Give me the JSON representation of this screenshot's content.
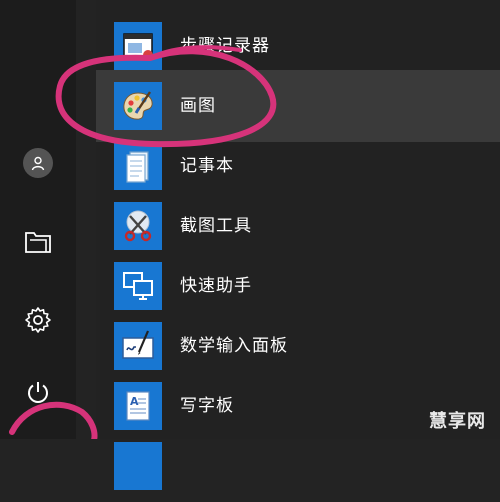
{
  "start_menu": {
    "apps": [
      {
        "label": "步骤记录器",
        "icon": "steps-recorder-icon"
      },
      {
        "label": "画图",
        "icon": "paint-palette-icon"
      },
      {
        "label": "记事本",
        "icon": "notepad-icon"
      },
      {
        "label": "截图工具",
        "icon": "snipping-tool-icon"
      },
      {
        "label": "快速助手",
        "icon": "quick-assist-icon"
      },
      {
        "label": "数学输入面板",
        "icon": "math-input-panel-icon"
      },
      {
        "label": "写字板",
        "icon": "wordpad-icon"
      }
    ],
    "selected_app": "画图",
    "rail_icons": [
      "user-avatar-icon",
      "documents-icon",
      "settings-gear-icon",
      "power-icon"
    ]
  },
  "colors": {
    "tile_blue": "#1877d2",
    "highlight_annotation": "#d6337a",
    "background": "#222222",
    "selected_row": "#3a3a3a"
  },
  "watermark": "慧享网"
}
